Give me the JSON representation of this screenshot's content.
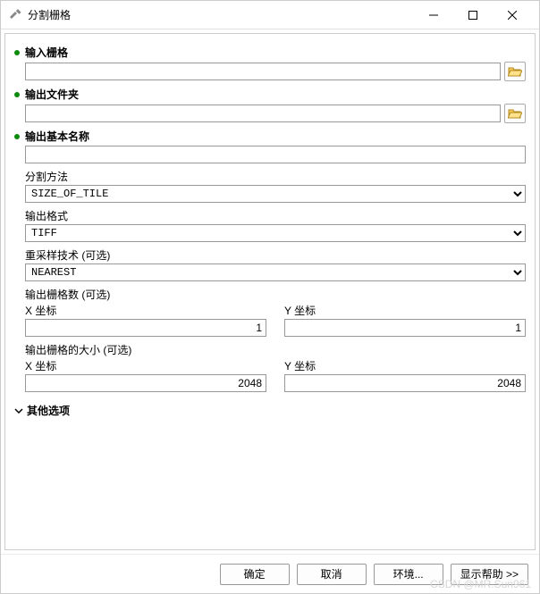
{
  "window": {
    "title": "分割栅格"
  },
  "params": {
    "input_raster_label": "输入栅格",
    "input_raster_value": "",
    "output_folder_label": "输出文件夹",
    "output_folder_value": "",
    "output_basename_label": "输出基本名称",
    "output_basename_value": "",
    "split_method_label": "分割方法",
    "split_method_value": "SIZE_OF_TILE",
    "output_format_label": "输出格式",
    "output_format_value": "TIFF",
    "resample_label": "重采样技术 (可选)",
    "resample_value": "NEAREST",
    "tiles_count_label": "输出栅格数 (可选)",
    "x_coord_label": "X 坐标",
    "y_coord_label": "Y 坐标",
    "tiles_x": "1",
    "tiles_y": "1",
    "tile_size_label": "输出栅格的大小 (可选)",
    "size_x": "2048",
    "size_y": "2048",
    "other_options_label": "其他选项"
  },
  "buttons": {
    "ok": "确定",
    "cancel": "取消",
    "env": "环境...",
    "help": "显示帮助 >>"
  },
  "watermark": "CSDN @MR.Sun961"
}
